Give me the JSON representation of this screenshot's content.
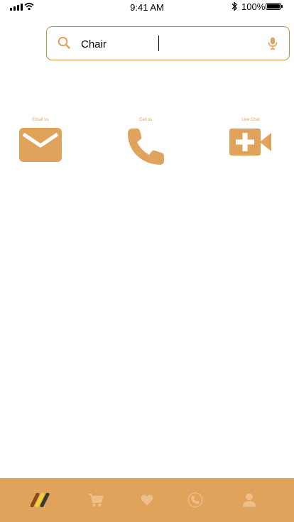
{
  "status_bar": {
    "time": "9:41 AM",
    "battery": "100%",
    "icons": [
      "signal-icon",
      "wifi-icon",
      "bluetooth-icon",
      "battery-icon"
    ]
  },
  "search": {
    "value": "Chair",
    "placeholder": "",
    "icons": [
      "search-icon",
      "microphone-icon"
    ]
  },
  "contact_options": [
    {
      "label": "Email us",
      "icon": "envelope-icon"
    },
    {
      "label": "Call us",
      "icon": "phone-icon"
    },
    {
      "label": "Live Chat",
      "icon": "video-plus-icon"
    }
  ],
  "tab_bar": {
    "items": [
      {
        "name": "home",
        "icon": "brand-logo-icon",
        "active": true
      },
      {
        "name": "cart",
        "icon": "cart-icon",
        "active": false
      },
      {
        "name": "favorites",
        "icon": "heart-icon",
        "active": false
      },
      {
        "name": "support",
        "icon": "phone-circle-icon",
        "active": false
      },
      {
        "name": "profile",
        "icon": "person-icon",
        "active": false
      }
    ]
  },
  "colors": {
    "accent": "#e0a35c",
    "accent_dark": "#c98a3c",
    "tab_inactive": "#eebf86",
    "logo_yellow": "#f4d03f",
    "logo_dark": "#3a3a2a",
    "logo_brown": "#8b4a1c"
  }
}
